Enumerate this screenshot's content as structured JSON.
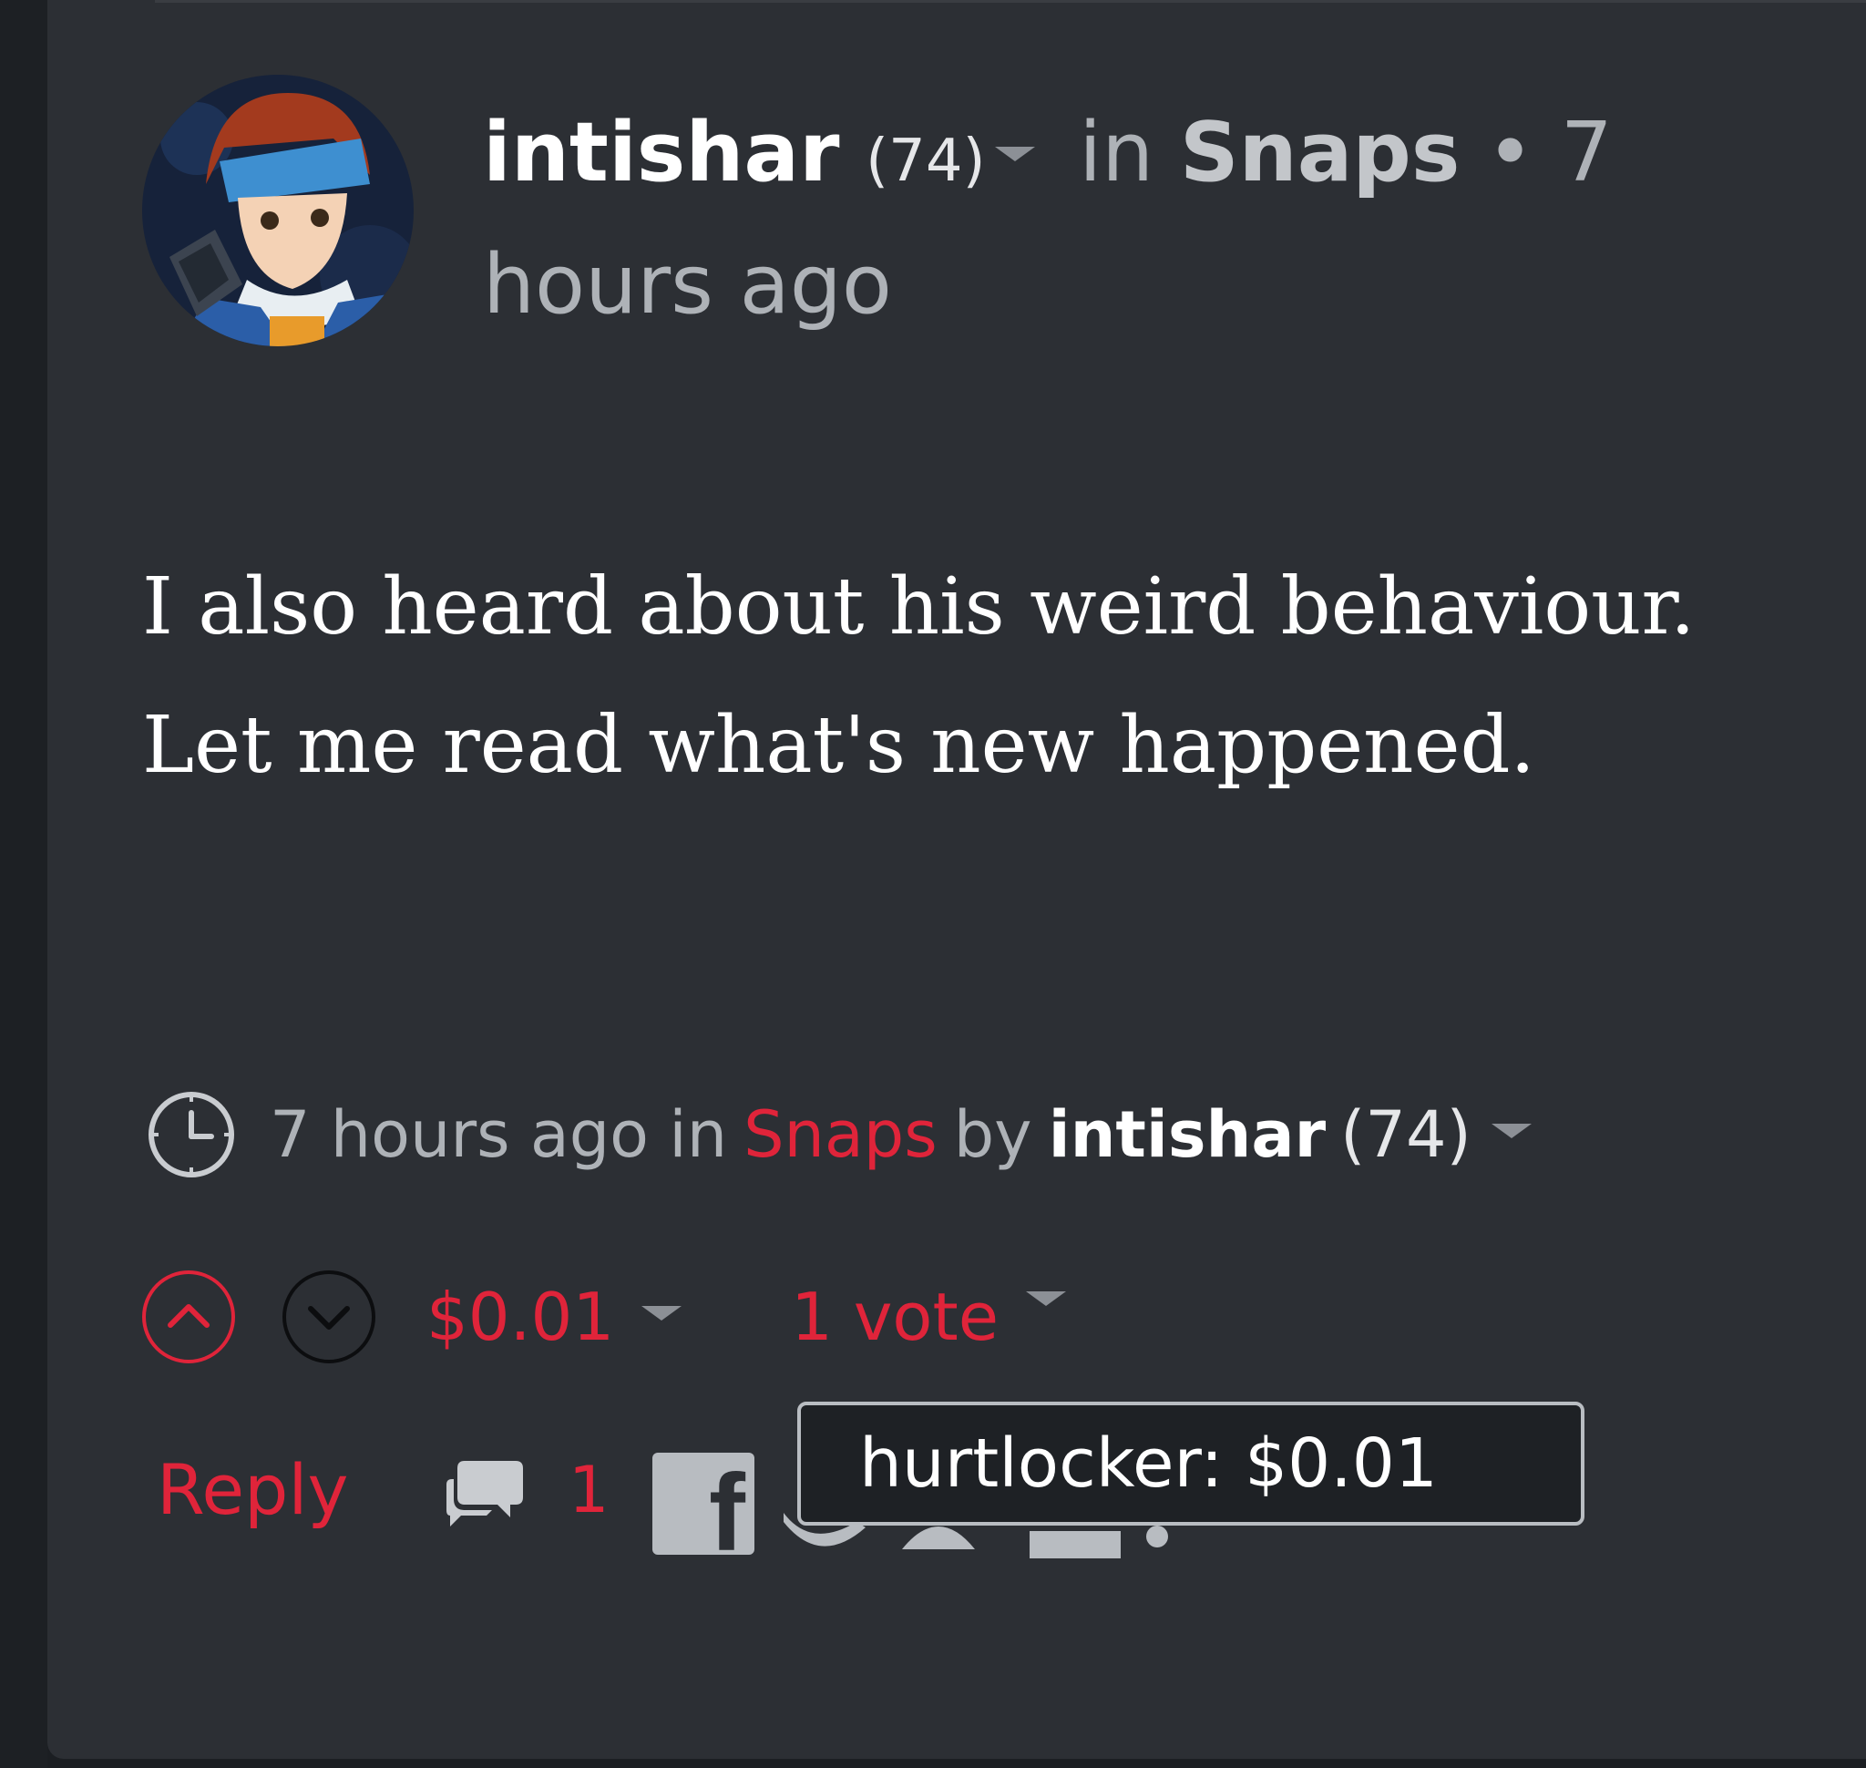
{
  "post": {
    "author": "intishar",
    "reputation": "(74)",
    "in_label": "in",
    "community": "Snaps",
    "separator": "•",
    "time_ago": "7 hours ago",
    "body_lines": [
      "I also heard about his weird behaviour.",
      "Let me read what's new happened."
    ]
  },
  "meta": {
    "time_ago": "7 hours ago",
    "in_label": "in",
    "community": "Snaps",
    "by_label": "by",
    "author": "intishar",
    "reputation": "(74)"
  },
  "voting": {
    "payout": "$0.01",
    "votes": "1 vote",
    "tooltip": "hurtlocker: $0.01"
  },
  "actions": {
    "reply_label": "Reply",
    "comment_count": "1"
  },
  "icons": {
    "clock": "clock-icon",
    "upvote": "chevron-up-circle-icon",
    "downvote": "chevron-down-circle-icon",
    "comments": "comments-icon",
    "facebook": "facebook-icon",
    "dropdown": "caret-down-icon"
  },
  "colors": {
    "accent": "#e0243a",
    "background": "#2c2f34",
    "text": "#ffffff",
    "muted": "#aeb2b7"
  }
}
